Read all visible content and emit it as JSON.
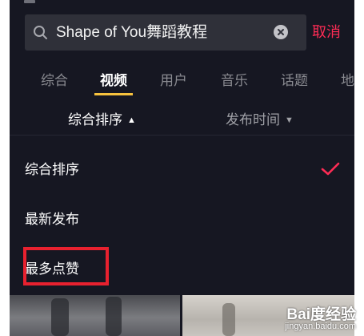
{
  "search": {
    "query": "Shape of You舞蹈教程",
    "cancel_label": "取消"
  },
  "tabs": [
    {
      "label": "综合",
      "active": false
    },
    {
      "label": "视频",
      "active": true
    },
    {
      "label": "用户",
      "active": false
    },
    {
      "label": "音乐",
      "active": false
    },
    {
      "label": "话题",
      "active": false
    },
    {
      "label": "地",
      "active": false
    }
  ],
  "sort_bar": {
    "primary": {
      "label": "综合排序",
      "arrow": "▲"
    },
    "secondary": {
      "label": "发布时间",
      "arrow": "▼"
    }
  },
  "sort_options": [
    {
      "label": "综合排序",
      "selected": true
    },
    {
      "label": "最新发布",
      "selected": false
    },
    {
      "label": "最多点赞",
      "selected": false,
      "highlighted": true
    }
  ],
  "watermark": {
    "logo": "Bai度经验",
    "url": "jingyan.baidu.com"
  },
  "colors": {
    "background": "#161722",
    "accent_red": "#fe2c55",
    "tab_indicator": "#f7c23e",
    "highlight_box": "#e8212f"
  }
}
